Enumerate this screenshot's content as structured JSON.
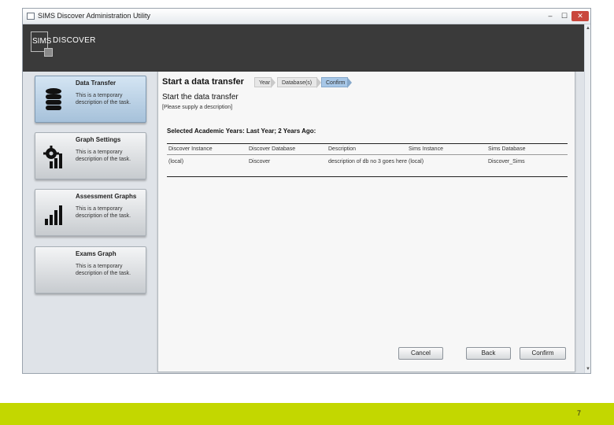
{
  "window": {
    "title": "SIMS Discover Administration Utility",
    "controls": {
      "minimize": "–",
      "maximize": "☐",
      "close": "✕"
    }
  },
  "header": {
    "logo_sims": "SIMS",
    "logo_discover": "DISCOVER"
  },
  "sidebar": {
    "tasks": [
      {
        "title": "Data Transfer",
        "description": "This is a temporary description of the task.",
        "icon": "database-icon",
        "active": true
      },
      {
        "title": "Graph Settings",
        "description": "This is a temporary description of the task.",
        "icon": "gear-chart-icon",
        "active": false
      },
      {
        "title": "Assessment Graphs",
        "description": "This is a temporary description of the task.",
        "icon": "bar-chart-icon",
        "active": false
      },
      {
        "title": "Exams Graph",
        "description": "This is a temporary description of the task.",
        "icon": "",
        "active": false
      }
    ]
  },
  "main": {
    "title": "Start a data transfer",
    "breadcrumbs": [
      "Year",
      "Database(s)",
      "Confirm"
    ],
    "active_breadcrumb": "Confirm",
    "subtitle": "Start the data transfer",
    "description_hint": "[Please supply a description]",
    "selected_years": "Selected Academic Years:  Last Year;  2 Years Ago:",
    "table": {
      "headers": [
        "Discover Instance",
        "Discover Database",
        "Description",
        "Sims Instance",
        "Sims Database"
      ],
      "rows": [
        [
          "(local)",
          "Discover",
          "description of db no 3 goes here",
          "(local)",
          "Discover_Sims"
        ]
      ]
    },
    "buttons": {
      "cancel": "Cancel",
      "back": "Back",
      "confirm": "Confirm"
    }
  },
  "footer": {
    "page_number": "7"
  },
  "colors": {
    "header_band": "#3a3a3a",
    "active_task": "#a6c1da",
    "active_breadcrumb": "#a7c7e7",
    "footer_band": "#c3d700"
  }
}
